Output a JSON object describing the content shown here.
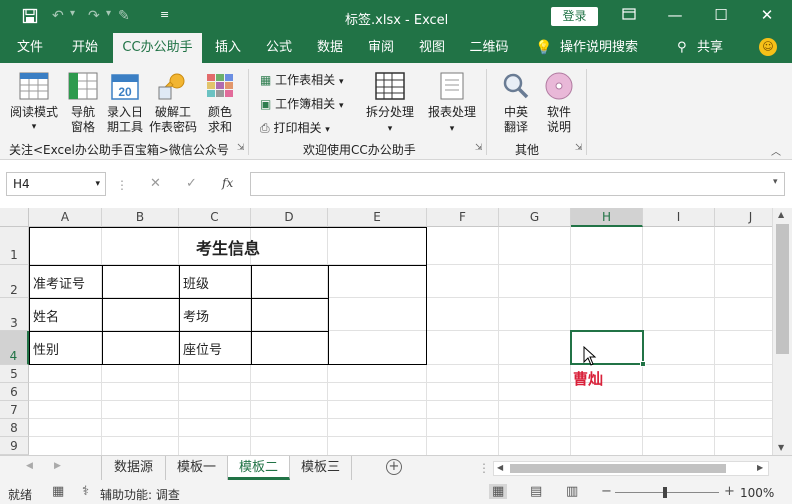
{
  "titlebar": {
    "title": "标签.xlsx  -  Excel",
    "login": "登录",
    "accent": "#217346",
    "icons": [
      "save-icon",
      "undo-icon",
      "redo-icon",
      "touch-mode-icon",
      "customize-icon"
    ]
  },
  "tabs": [
    "文件",
    "开始",
    "CC办公助手",
    "插入",
    "公式",
    "数据",
    "审阅",
    "视图",
    "二维码",
    "操作说明搜索",
    "共享"
  ],
  "ribbon": {
    "group1": {
      "buttons": [
        {
          "line1": "阅读模式",
          "line2": "▾"
        },
        {
          "line1": "导航",
          "line2": "窗格"
        },
        {
          "line1": "录入日",
          "line2": "期工具"
        },
        {
          "line1": "破解工",
          "line2": "作表密码"
        },
        {
          "line1": "颜色",
          "line2": "求和"
        }
      ],
      "label": "关注<Excel办公助手百宝箱>微信公众号",
      "cal_num": "20"
    },
    "group2": {
      "small": [
        "工作表相关",
        "工作簿相关",
        "打印相关"
      ],
      "split": "拆分处理",
      "report": "报表处理",
      "label": "欢迎使用CC办公助手"
    },
    "group3": {
      "buttons": [
        {
          "line1": "中英",
          "line2": "翻译"
        },
        {
          "line1": "软件",
          "line2": "说明"
        }
      ],
      "label": "其他"
    }
  },
  "formula": {
    "namebox": "H4",
    "fx": "fx",
    "cancel": "✕",
    "confirm": "✓",
    "value": ""
  },
  "columns": [
    "A",
    "B",
    "C",
    "D",
    "E",
    "F",
    "G",
    "H",
    "I",
    "J"
  ],
  "rows": [
    "1",
    "2",
    "3",
    "4",
    "5",
    "6",
    "7",
    "8",
    "9"
  ],
  "table": {
    "title": "考生信息",
    "labels": [
      "准考证号",
      "姓名",
      "性别"
    ],
    "labels2": [
      "班级",
      "考场",
      "座位号"
    ]
  },
  "annotation": {
    "text": "曹灿",
    "color": "#d9213a"
  },
  "sheets": [
    "数据源",
    "模板一",
    "模板二",
    "模板三"
  ],
  "active_sheet": "模板二",
  "status": {
    "ready": "就绪",
    "accessibility": "辅助功能: 调查",
    "zoom": "100%"
  }
}
